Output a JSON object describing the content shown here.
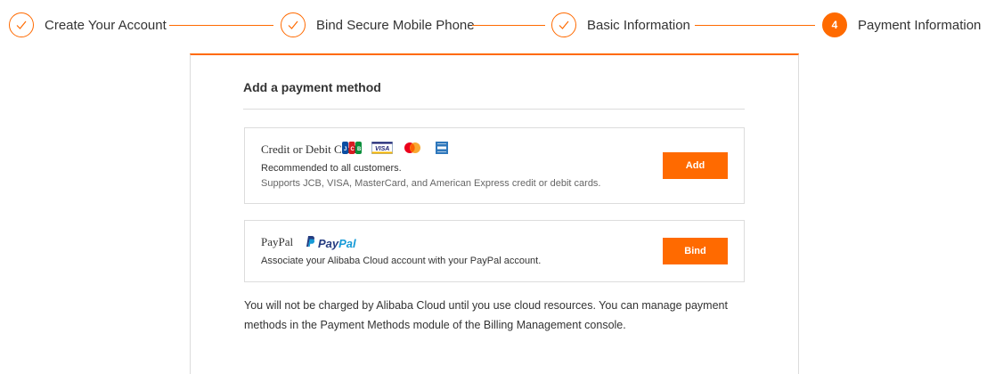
{
  "stepper": {
    "steps": [
      {
        "label": "Create Your Account",
        "state": "done"
      },
      {
        "label": "Bind Secure Mobile Phone",
        "state": "done"
      },
      {
        "label": "Basic Information",
        "state": "done"
      },
      {
        "label": "Payment Information",
        "state": "current",
        "number": "4"
      }
    ]
  },
  "card": {
    "title": "Add a payment method",
    "methods": [
      {
        "name": "Credit or Debit Card",
        "logos": [
          "jcb-logo",
          "visa-logo",
          "mastercard-logo",
          "amex-logo"
        ],
        "line1": "Recommended to all customers.",
        "line2": "Supports JCB, VISA, MasterCard, and American Express credit or debit cards.",
        "button": "Add"
      },
      {
        "name": "PayPal",
        "logo_text": {
          "pay": "Pay",
          "pal": "Pal"
        },
        "line1": "Associate your Alibaba Cloud account with your PayPal account.",
        "button": "Bind"
      }
    ],
    "footnote": "You will not be charged by Alibaba Cloud until you use cloud resources. You can manage payment methods in the Payment Methods module of the Billing Management console."
  },
  "colors": {
    "accent": "#ff6a00",
    "border": "#dcdcdc",
    "text": "#333333",
    "muted": "#666666",
    "paypal_dark": "#253b80",
    "paypal_light": "#179bd7"
  }
}
